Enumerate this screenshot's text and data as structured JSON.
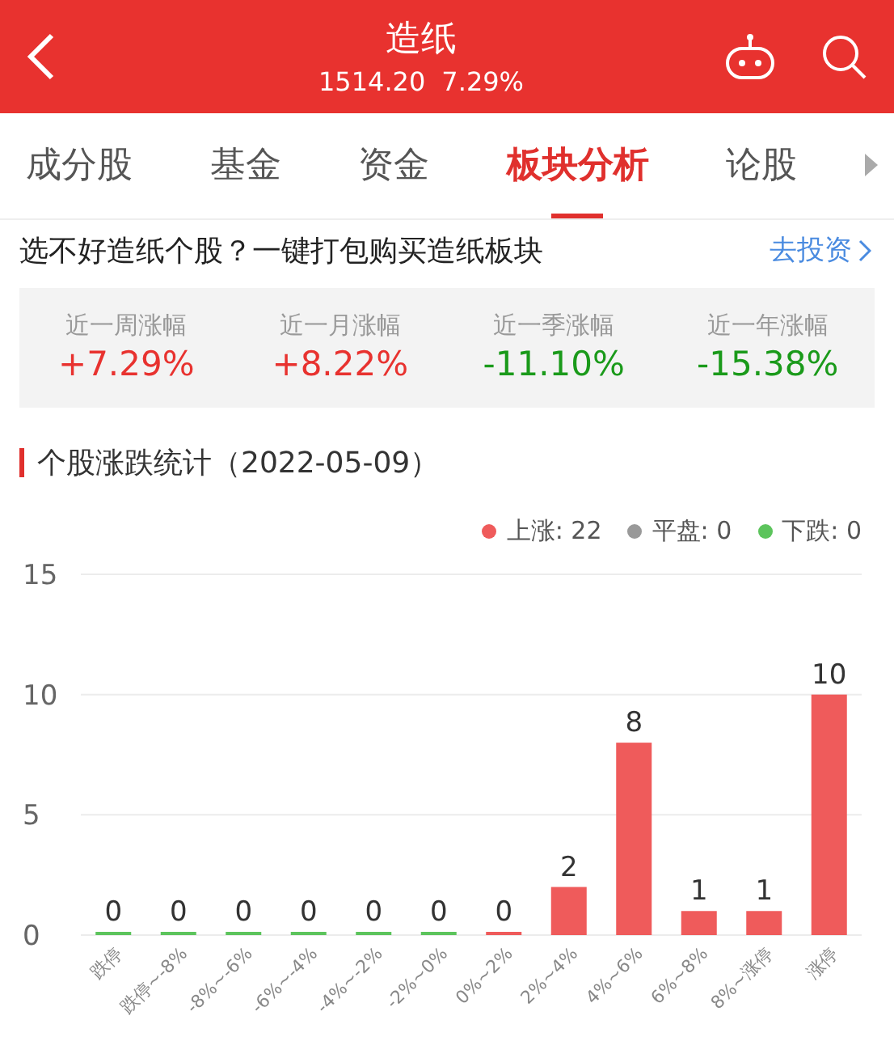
{
  "header": {
    "title": "造纸",
    "price": "1514.20",
    "change": "7.29%"
  },
  "tabs": [
    {
      "label": "成分股",
      "selected": false
    },
    {
      "label": "基金",
      "selected": false
    },
    {
      "label": "资金",
      "selected": false
    },
    {
      "label": "板块分析",
      "selected": true
    },
    {
      "label": "论股",
      "selected": false
    }
  ],
  "promo": {
    "text": "选不好造纸个股？一键打包购买造纸板块",
    "link": "去投资"
  },
  "stats": [
    {
      "label": "近一周涨幅",
      "value": "+7.29%",
      "color": "#e8322f"
    },
    {
      "label": "近一月涨幅",
      "value": "+8.22%",
      "color": "#e8322f"
    },
    {
      "label": "近一季涨幅",
      "value": "-11.10%",
      "color": "#1a9a1a"
    },
    {
      "label": "近一年涨幅",
      "value": "-15.38%",
      "color": "#1a9a1a"
    }
  ],
  "section_title": "个股涨跌统计（2022-05-09）",
  "legend": [
    {
      "label": "上涨: 22",
      "color": "#ef5b5b"
    },
    {
      "label": "平盘: 0",
      "color": "#999999"
    },
    {
      "label": "下跌: 0",
      "color": "#5cc45c"
    }
  ],
  "chart_data": {
    "type": "bar",
    "data_labels": true,
    "categories": [
      "跌停",
      "跌停~-8%",
      "-8%~-6%",
      "-6%~-4%",
      "-4%~-2%",
      "-2%~0%",
      "0%~2%",
      "2%~4%",
      "4%~6%",
      "6%~8%",
      "8%~涨停",
      "涨停"
    ],
    "ylim": [
      0,
      15
    ],
    "yticks": [
      0,
      5,
      10,
      15
    ],
    "series": [
      {
        "color": "#5cc45c",
        "values": [
          0,
          0,
          0,
          0,
          0,
          0,
          null,
          null,
          null,
          null,
          null,
          null
        ]
      },
      {
        "color": "#ef5b5b",
        "values": [
          null,
          null,
          null,
          null,
          null,
          null,
          0,
          2,
          8,
          1,
          1,
          10
        ]
      }
    ]
  }
}
